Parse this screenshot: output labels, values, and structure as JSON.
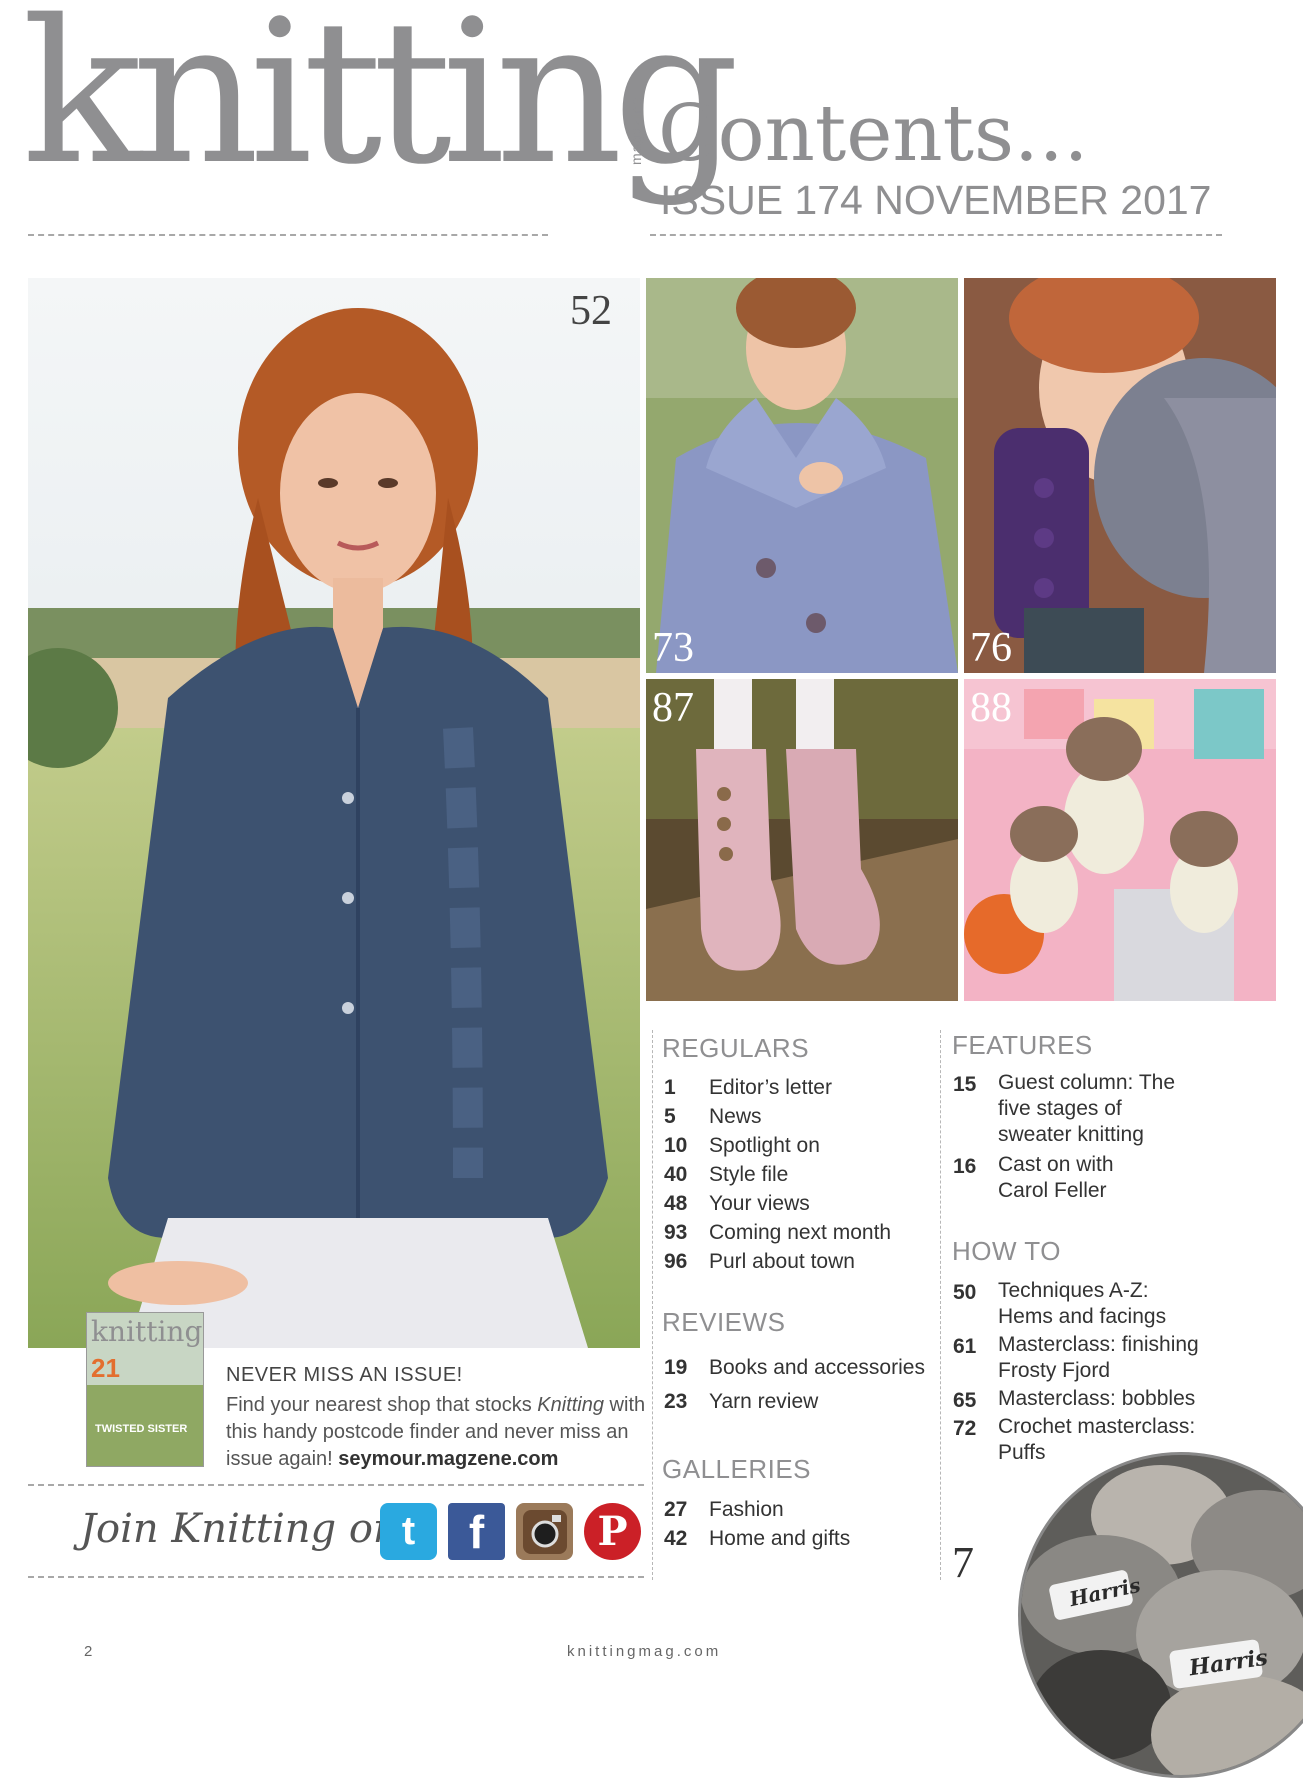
{
  "masthead": {
    "logo": "knitting",
    "logo_sub": "magazine",
    "title": "Contents...",
    "issue": "ISSUE 174 NOVEMBER 2017"
  },
  "photos": {
    "main_page": "52",
    "p73": "73",
    "p76": "76",
    "p87": "87",
    "p88": "88"
  },
  "cover_thumb": {
    "title": "knitting",
    "number": "21",
    "cover_text": "TWISTED SISTER"
  },
  "subscribe": {
    "heading": "NEVER MISS AN ISSUE!",
    "body_part1": "Find your nearest shop that stocks ",
    "body_italic": "Knitting",
    "body_part2": " with this handy postcode finder and never miss an issue again! ",
    "link": "seymour.magzene.com"
  },
  "social": {
    "label": "Join Knitting on...",
    "twitter": "t",
    "facebook": "f",
    "pinterest": "P"
  },
  "regulars": {
    "heading": "REGULARS",
    "items": [
      {
        "num": "1",
        "title": "Editor’s letter"
      },
      {
        "num": "5",
        "title": "News"
      },
      {
        "num": "10",
        "title": "Spotlight on"
      },
      {
        "num": "40",
        "title": "Style file"
      },
      {
        "num": "48",
        "title": "Your views"
      },
      {
        "num": "93",
        "title": "Coming next month"
      },
      {
        "num": "96",
        "title": "Purl about town"
      }
    ]
  },
  "reviews": {
    "heading": "REVIEWS",
    "items": [
      {
        "num": "19",
        "title": "Books and accessories"
      },
      {
        "num": "23",
        "title": "Yarn review"
      }
    ]
  },
  "galleries": {
    "heading": "GALLERIES",
    "items": [
      {
        "num": "27",
        "title": "Fashion"
      },
      {
        "num": "42",
        "title": "Home and gifts"
      }
    ]
  },
  "features": {
    "heading": "FEATURES",
    "items": [
      {
        "num": "15",
        "title": "Guest column: The five stages of sweater knitting"
      },
      {
        "num": "16",
        "title": "Cast on with Carol Feller"
      }
    ]
  },
  "howto": {
    "heading": "HOW TO",
    "items": [
      {
        "num": "50",
        "title": "Techniques A-Z: Hems and facings"
      },
      {
        "num": "61",
        "title": "Masterclass: finishing Frosty Fjord"
      },
      {
        "num": "65",
        "title": "Masterclass: bobbles"
      },
      {
        "num": "72",
        "title": "Crochet masterclass: Puffs"
      }
    ]
  },
  "yarn_photo": {
    "page": "7",
    "label_1": "Harris",
    "label_2": "Harris"
  },
  "footer": {
    "page_number": "2",
    "url": "knittingmag.com"
  }
}
